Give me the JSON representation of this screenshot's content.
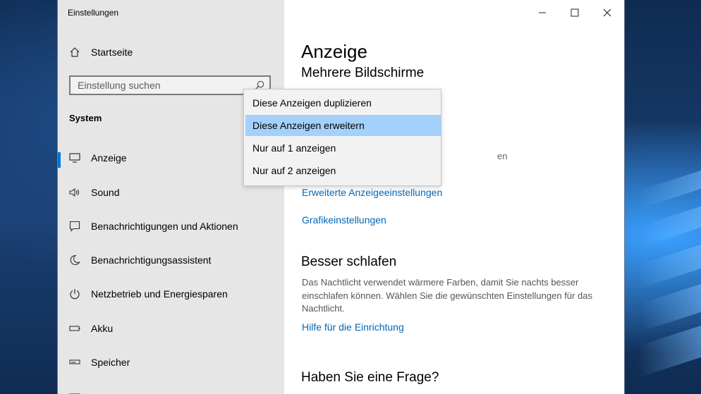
{
  "window": {
    "title": "Einstellungen"
  },
  "sidebar": {
    "home_label": "Startseite",
    "search_placeholder": "Einstellung suchen",
    "section_label": "System",
    "items": [
      {
        "label": "Anzeige",
        "icon": "monitor-icon",
        "active": true
      },
      {
        "label": "Sound",
        "icon": "speaker-icon"
      },
      {
        "label": "Benachrichtigungen und Aktionen",
        "icon": "notification-icon"
      },
      {
        "label": "Benachrichtigungsassistent",
        "icon": "moon-icon"
      },
      {
        "label": "Netzbetrieb und Energiesparen",
        "icon": "power-icon"
      },
      {
        "label": "Akku",
        "icon": "battery-icon"
      },
      {
        "label": "Speicher",
        "icon": "storage-icon"
      }
    ]
  },
  "main": {
    "title": "Anzeige",
    "multi_display_heading": "Mehrere Bildschirme",
    "dropdown": {
      "options": [
        "Diese Anzeigen duplizieren",
        "Diese Anzeigen erweitern",
        "Nur auf 1 anzeigen",
        "Nur auf 2 anzeigen"
      ],
      "selected_index": 1
    },
    "hidden_text_fragment": "en",
    "advanced_display_link": "Erweiterte Anzeigeeinstellungen",
    "graphics_link": "Grafikeinstellungen",
    "sleep_heading": "Besser schlafen",
    "sleep_description": "Das Nachtlicht verwendet wärmere Farben, damit Sie nachts besser einschlafen können. Wählen Sie die gewünschten Einstellungen für das Nachtlicht.",
    "setup_help_link": "Hilfe für die Einrichtung",
    "question_heading": "Haben Sie eine Frage?"
  },
  "colors": {
    "accent": "#0078d4",
    "link": "#0067b8",
    "selection": "#a3d1fb",
    "sidebar_bg": "#e6e6e6"
  }
}
